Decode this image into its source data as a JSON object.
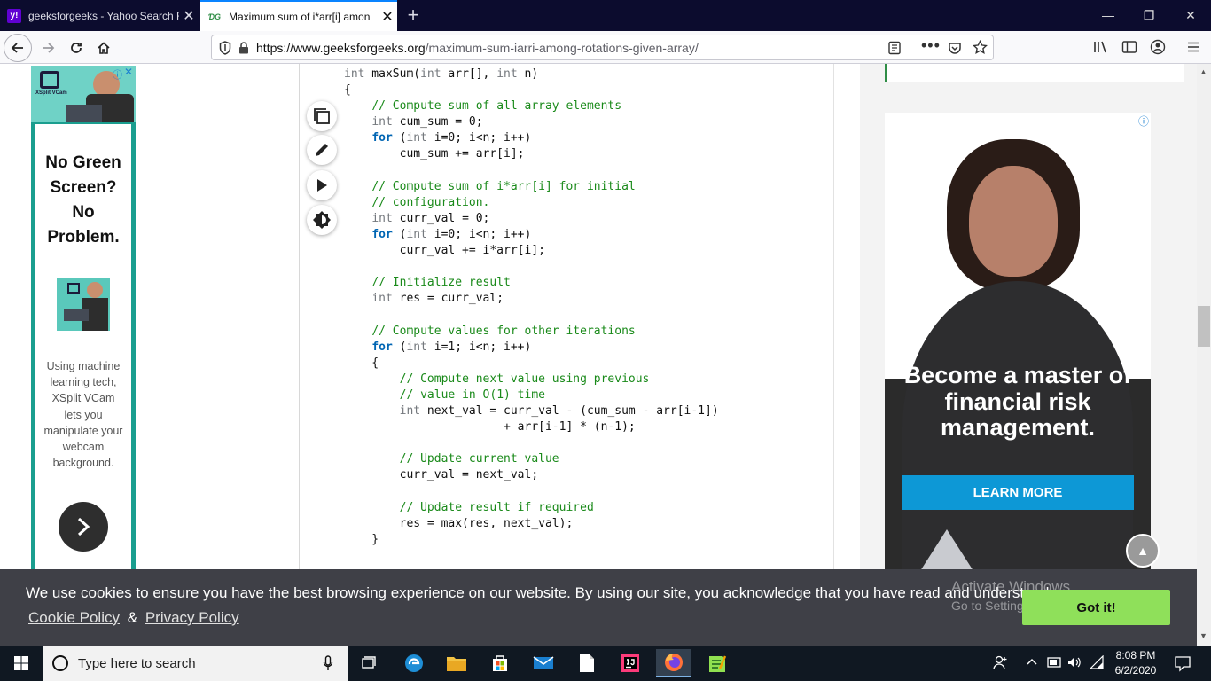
{
  "browser": {
    "tabs": [
      {
        "title": "geeksforgeeks - Yahoo Search R",
        "favicon": "yahoo-icon",
        "active": false
      },
      {
        "title": "Maximum sum of i*arr[i] amon",
        "favicon": "gfg-icon",
        "active": true
      }
    ],
    "url_host": "https://www.geeksforgeeks.org",
    "url_path": "/maximum-sum-iarri-among-rotations-given-array/"
  },
  "left_ad": {
    "brand": "XSplit VCam",
    "headline": "No Green Screen? No Problem.",
    "body": "Using machine learning tech, XSplit VCam lets you manipulate your webcam background."
  },
  "right_ad": {
    "headline": "Become a master of financial risk management.",
    "cta": "LEARN MORE"
  },
  "code_lines": [
    "int maxSum(int arr[], int n)",
    "{",
    "    // Compute sum of all array elements",
    "    int cum_sum = 0;",
    "    for (int i=0; i<n; i++)",
    "        cum_sum += arr[i];",
    "",
    "    // Compute sum of i*arr[i] for initial",
    "    // configuration.",
    "    int curr_val = 0;",
    "    for (int i=0; i<n; i++)",
    "        curr_val += i*arr[i];",
    "",
    "    // Initialize result",
    "    int res = curr_val;",
    "",
    "    // Compute values for other iterations",
    "    for (int i=1; i<n; i++)",
    "    {",
    "        // Compute next value using previous",
    "        // value in O(1) time",
    "        int next_val = curr_val - (cum_sum - arr[i-1])",
    "                       + arr[i-1] * (n-1);",
    "",
    "        // Update current value",
    "        curr_val = next_val;",
    "",
    "        // Update result if required",
    "        res = max(res, next_val);",
    "    }"
  ],
  "cookie": {
    "message": "We use cookies to ensure you have the best browsing experience on our website. By using our site, you acknowledge that you have read and understood our",
    "cookie_policy": "Cookie Policy",
    "amp": "&",
    "privacy_policy": "Privacy Policy",
    "button": "Got it!"
  },
  "watermark": {
    "line1": "Activate Windows",
    "line2": "Go to Settings to activate Windows."
  },
  "taskbar": {
    "search_placeholder": "Type here to search",
    "time": "8:08 PM",
    "date": "6/2/2020"
  }
}
